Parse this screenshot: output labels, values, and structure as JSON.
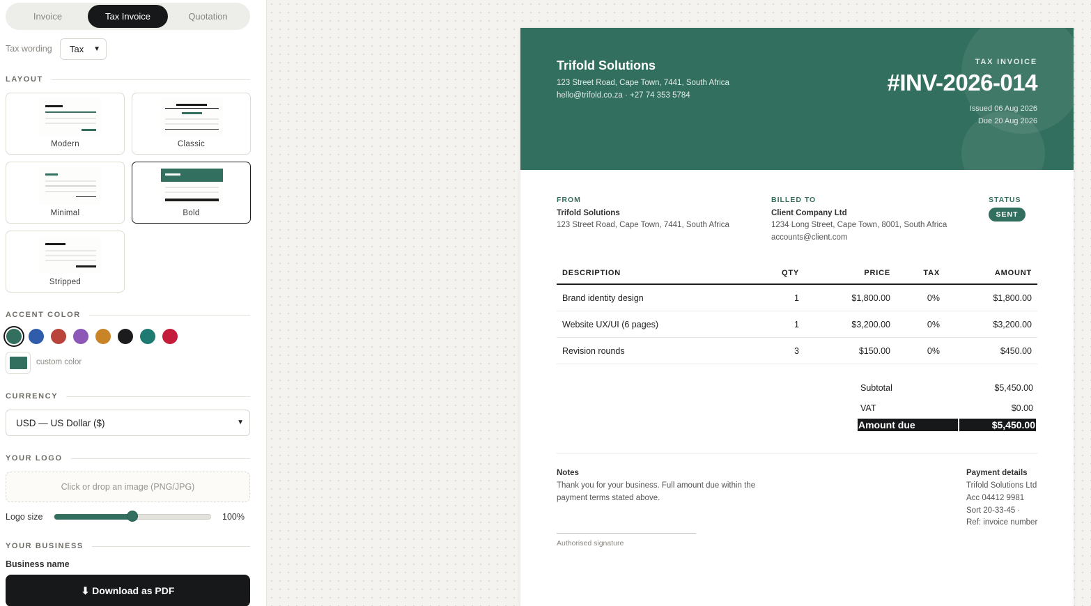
{
  "doc_type_tabs": [
    {
      "label": "Invoice",
      "active": false
    },
    {
      "label": "Tax Invoice",
      "active": true
    },
    {
      "label": "Quotation",
      "active": false
    }
  ],
  "tax_wording": {
    "label": "Tax wording",
    "value": "Tax"
  },
  "sections": {
    "layout": "LAYOUT",
    "accent": "ACCENT COLOR",
    "currency": "CURRENCY",
    "logo": "YOUR LOGO",
    "business": "YOUR BUSINESS"
  },
  "layouts": [
    {
      "name": "Modern",
      "selected": false
    },
    {
      "name": "Classic",
      "selected": false
    },
    {
      "name": "Minimal",
      "selected": false
    },
    {
      "name": "Bold",
      "selected": true
    },
    {
      "name": "Stripped",
      "selected": false
    }
  ],
  "accent_colors": [
    "#336f5e",
    "#2f5cab",
    "#b8443c",
    "#8e58b8",
    "#c98428",
    "#1b1b1e",
    "#1e7a72",
    "#c41d3c"
  ],
  "accent_selected": "#336f5e",
  "custom_color_label": "custom color",
  "currency_value": "USD — US Dollar ($)",
  "logo_drop_text": "Click or drop an image (PNG/JPG)",
  "logo_size": {
    "label": "Logo size",
    "value_text": "100%",
    "fraction": 0.5
  },
  "business_name_label": "Business name",
  "download_label": "⬇ Download as PDF",
  "invoice": {
    "business_name": "Trifold Solutions",
    "business_address": "123 Street Road, Cape Town, 7441, South Africa",
    "business_contact": "hello@trifold.co.za · +27 74 353 5784",
    "doc_kind": "TAX INVOICE",
    "number": "#INV-2026-014",
    "issued": "Issued 06 Aug 2026",
    "due": "Due 20 Aug 2026",
    "from_label": "FROM",
    "from_name": "Trifold Solutions",
    "from_address": "123 Street Road, Cape Town, 7441, South Africa",
    "billed_label": "BILLED TO",
    "billed_name": "Client Company Ltd",
    "billed_address": "1234 Long Street, Cape Town, 8001, South Africa",
    "billed_email": "accounts@client.com",
    "status_label": "STATUS",
    "status": "SENT",
    "columns": {
      "description": "DESCRIPTION",
      "qty": "QTY",
      "price": "PRICE",
      "tax": "TAX",
      "amount": "AMOUNT"
    },
    "items": [
      {
        "description": "Brand identity design",
        "qty": "1",
        "price": "$1,800.00",
        "tax": "0%",
        "amount": "$1,800.00"
      },
      {
        "description": "Website UX/UI (6 pages)",
        "qty": "1",
        "price": "$3,200.00",
        "tax": "0%",
        "amount": "$3,200.00"
      },
      {
        "description": "Revision rounds",
        "qty": "3",
        "price": "$150.00",
        "tax": "0%",
        "amount": "$450.00"
      }
    ],
    "subtotal_label": "Subtotal",
    "subtotal": "$5,450.00",
    "vat_label": "VAT",
    "vat": "$0.00",
    "amount_due_label": "Amount due",
    "amount_due": "$5,450.00",
    "notes_title": "Notes",
    "notes_body": "Thank you for your business. Full amount due within the payment terms stated above.",
    "payment_title": "Payment details",
    "payment_lines": [
      "Trifold Solutions Ltd",
      "Acc 04412 9981",
      "Sort 20-33-45 ·",
      "Ref: invoice number"
    ],
    "signature_label": "Authorised signature"
  }
}
